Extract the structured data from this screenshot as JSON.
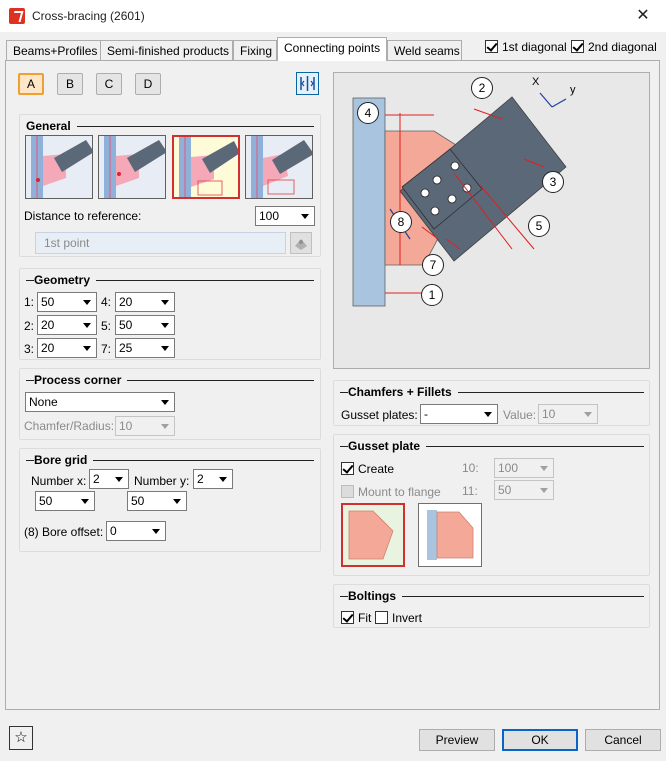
{
  "window": {
    "title": "Cross-bracing (2601)",
    "close_glyph": "✕"
  },
  "tabs": [
    {
      "label": "Beams+Profiles"
    },
    {
      "label": "Semi-finished products"
    },
    {
      "label": "Fixing"
    },
    {
      "label": "Connecting points"
    },
    {
      "label": "Weld seams"
    }
  ],
  "diagonals": {
    "first": {
      "label": "1st diagonal",
      "checked": true
    },
    "second": {
      "label": "2nd diagonal",
      "checked": true
    }
  },
  "variants": [
    "A",
    "B",
    "C",
    "D"
  ],
  "general": {
    "title": "General",
    "distance_label": "Distance to reference:",
    "distance_value": "100",
    "point_placeholder": "1st point"
  },
  "geometry": {
    "title": "Geometry",
    "fields": [
      {
        "label": "1:",
        "value": "50"
      },
      {
        "label": "4:",
        "value": "20"
      },
      {
        "label": "2:",
        "value": "20"
      },
      {
        "label": "5:",
        "value": "50"
      },
      {
        "label": "3:",
        "value": "20"
      },
      {
        "label": "7:",
        "value": "25"
      }
    ]
  },
  "process_corner": {
    "title": "Process corner",
    "value": "None",
    "chamfer_label": "Chamfer/Radius:",
    "chamfer_value": "10"
  },
  "bore_grid": {
    "title": "Bore grid",
    "number_x_label": "Number x:",
    "number_x_value": "2",
    "number_y_label": "Number y:",
    "number_y_value": "2",
    "spacing_x": "50",
    "spacing_y": "50",
    "offset_label": "(8) Bore offset:",
    "offset_value": "0"
  },
  "diagram_labels": [
    "1",
    "2",
    "3",
    "4",
    "5",
    "7",
    "8"
  ],
  "diagram_axes": {
    "x": "X",
    "y": "y"
  },
  "chamfers": {
    "title": "Chamfers + Fillets",
    "gusset_label": "Gusset plates:",
    "gusset_value": "-",
    "value_label": "Value:",
    "value_value": "10"
  },
  "gusset_plate": {
    "title": "Gusset plate",
    "create_label": "Create",
    "create_checked": true,
    "mount_label": "Mount to flange",
    "field10_label": "10:",
    "field10_value": "100",
    "field11_label": "11:",
    "field11_value": "50"
  },
  "boltings": {
    "title": "Boltings",
    "fit_label": "Fit",
    "fit_checked": true,
    "invert_label": "Invert",
    "invert_checked": false
  },
  "buttons": {
    "preview": "Preview",
    "ok": "OK",
    "cancel": "Cancel",
    "star": "☆"
  },
  "colors": {
    "accent": "#0a64c8",
    "selected_border": "#d03030",
    "gusset": "#f4a898",
    "profile": "#5a6878"
  }
}
